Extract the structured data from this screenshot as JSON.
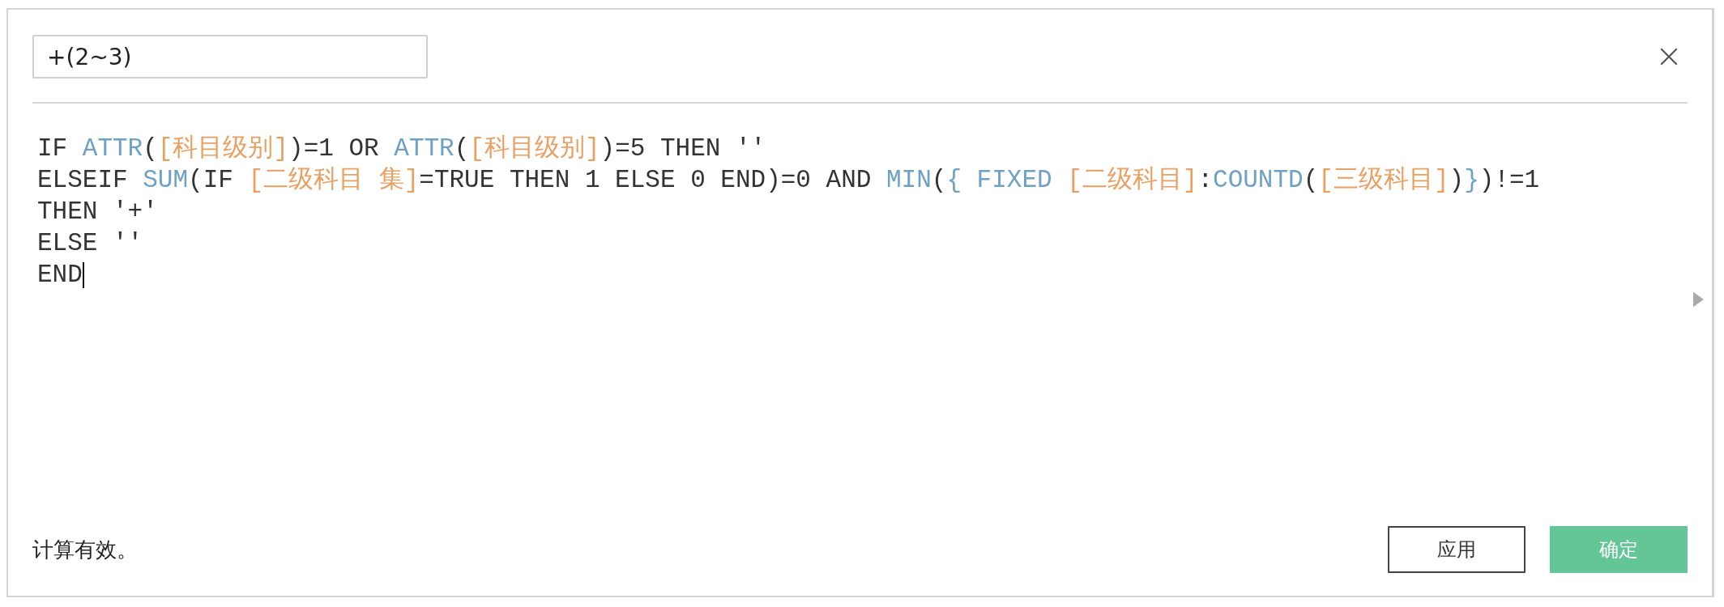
{
  "name_field": {
    "value": "+(2~3)"
  },
  "formula": {
    "cursor": true,
    "lines": [
      [
        {
          "kind": "plain",
          "text": "IF "
        },
        {
          "kind": "func",
          "text": "ATTR"
        },
        {
          "kind": "plain",
          "text": "("
        },
        {
          "kind": "field",
          "text": "[科目级别]"
        },
        {
          "kind": "plain",
          "text": ")=1 OR "
        },
        {
          "kind": "func",
          "text": "ATTR"
        },
        {
          "kind": "plain",
          "text": "("
        },
        {
          "kind": "field",
          "text": "[科目级别]"
        },
        {
          "kind": "plain",
          "text": ")=5 THEN ''"
        }
      ],
      [
        {
          "kind": "plain",
          "text": "ELSEIF "
        },
        {
          "kind": "func",
          "text": "SUM"
        },
        {
          "kind": "plain",
          "text": "(IF "
        },
        {
          "kind": "field",
          "text": "[二级科目 集]"
        },
        {
          "kind": "plain",
          "text": "=TRUE THEN 1 ELSE 0 END)=0 AND "
        },
        {
          "kind": "func",
          "text": "MIN"
        },
        {
          "kind": "plain",
          "text": "("
        },
        {
          "kind": "func",
          "text": "{ FIXED "
        },
        {
          "kind": "field",
          "text": "[二级科目]"
        },
        {
          "kind": "plain",
          "text": ":"
        },
        {
          "kind": "func",
          "text": "COUNTD"
        },
        {
          "kind": "plain",
          "text": "("
        },
        {
          "kind": "field",
          "text": "[三级科目]"
        },
        {
          "kind": "plain",
          "text": ")"
        },
        {
          "kind": "func",
          "text": "}"
        },
        {
          "kind": "plain",
          "text": ")!=1"
        }
      ],
      [
        {
          "kind": "plain",
          "text": "THEN '+'"
        }
      ],
      [
        {
          "kind": "plain",
          "text": "ELSE ''"
        }
      ],
      [
        {
          "kind": "plain",
          "text": "END"
        }
      ]
    ]
  },
  "status": "计算有效。",
  "buttons": [
    {
      "label": "应用",
      "kind": "secondary"
    },
    {
      "label": "确定",
      "kind": "primary"
    }
  ]
}
